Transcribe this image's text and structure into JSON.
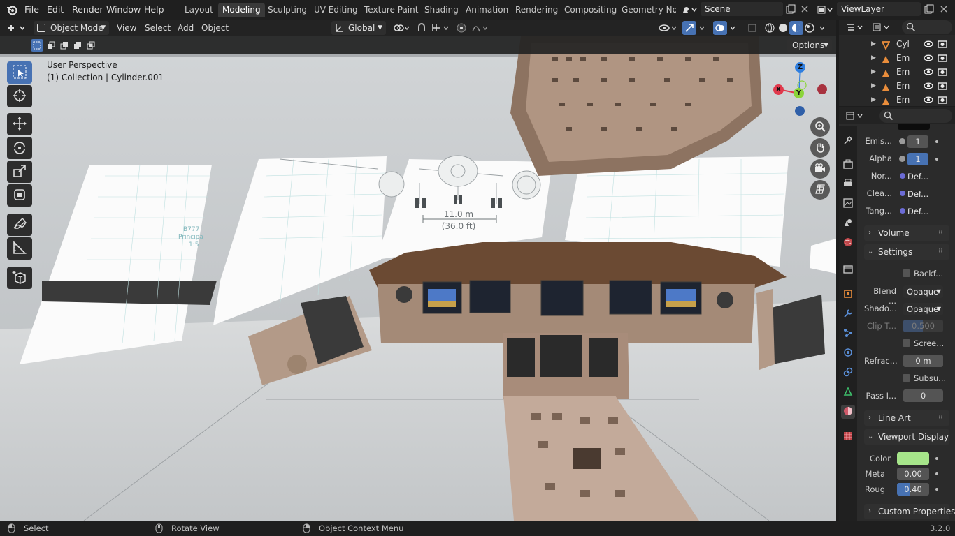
{
  "menu": {
    "file": "File",
    "edit": "Edit",
    "render": "Render",
    "window": "Window",
    "help": "Help"
  },
  "workspaces": [
    "Layout",
    "Modeling",
    "Sculpting",
    "UV Editing",
    "Texture Paint",
    "Shading",
    "Animation",
    "Rendering",
    "Compositing",
    "Geometry Noc"
  ],
  "scene": {
    "name": "Scene"
  },
  "viewlayer": {
    "name": "ViewLayer"
  },
  "header": {
    "mode": "Object Mode",
    "view": "View",
    "select": "Select",
    "add": "Add",
    "object": "Object",
    "orientation": "Global"
  },
  "viewport": {
    "options": "Options",
    "perspective": "User Perspective",
    "collection": "(1) Collection | Cylinder.001",
    "dim_m": "11.0 m",
    "dim_ft": "(36.0 ft)",
    "ref_label": "B777",
    "ref_sub": "Principa",
    "ref_scale": "1:5",
    "gizmo": {
      "x": "X",
      "y": "Y",
      "z": "Z"
    }
  },
  "outliner": {
    "items": [
      "Cyl",
      "Em",
      "Em",
      "Em",
      "Em"
    ]
  },
  "properties": {
    "emission_label": "Emis...",
    "emission_value": "1",
    "alpha_label": "Alpha",
    "alpha_value": "1",
    "normal_label": "Nor...",
    "normal_value": "Def...",
    "clearcoat_label": "Clea...",
    "clearcoat_value": "Def...",
    "tangent_label": "Tang...",
    "tangent_value": "Def...",
    "volume_panel": "Volume",
    "settings_panel": "Settings",
    "backface_label": "Backf...",
    "blend_label": "Blend ...",
    "blend_value": "Opaque",
    "shadow_label": "Shado...",
    "shadow_value": "Opaque",
    "clip_label": "Clip T...",
    "clip_value": "0.500",
    "screen_label": "Scree...",
    "refraction_label": "Refrac...",
    "refraction_value": "0 m",
    "subsurface_label": "Subsu...",
    "pass_label": "Pass I...",
    "pass_value": "0",
    "lineart_panel": "Line Art",
    "viewport_display_panel": "Viewport Display",
    "color_label": "Color",
    "color_value": "#a6e58a",
    "metal_label": "Meta",
    "metal_value": "0.00",
    "rough_label": "Roug",
    "rough_value": "0.40",
    "custom_props_panel": "Custom Properties"
  },
  "status": {
    "select": "Select",
    "rotate": "Rotate View",
    "context": "Object Context Menu",
    "version": "3.2.0"
  },
  "colors": {
    "accent": "#4772b3",
    "axis_x": "#e0394c",
    "axis_y": "#8bd43a",
    "axis_z": "#2f7fe0"
  }
}
